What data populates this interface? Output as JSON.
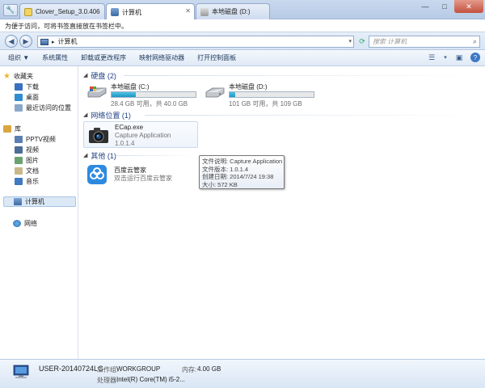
{
  "tabs": [
    {
      "label": "Clover_Setup_3.0.406",
      "active": false
    },
    {
      "label": "计算机",
      "active": true
    },
    {
      "label": "本地磁盘 (D:)",
      "active": false
    }
  ],
  "hint_bar": {
    "text": "为便于访问，可将书签直接放在书签栏中。"
  },
  "address": {
    "path": "计算机",
    "search_placeholder": "搜索 计算机"
  },
  "command_bar": {
    "items": [
      "组织 ▼",
      "系统属性",
      "卸载或更改程序",
      "映射网络驱动器",
      "打开控制面板"
    ]
  },
  "nav": {
    "favorites": {
      "label": "收藏夹",
      "items": [
        "下载",
        "桌面",
        "最近访问的位置"
      ]
    },
    "libraries": {
      "label": "库",
      "items": [
        "PPTV视频",
        "视频",
        "图片",
        "文档",
        "音乐"
      ]
    },
    "computer": "计算机",
    "network": "网络"
  },
  "groups": {
    "disks": {
      "header": "硬盘 (2)"
    },
    "network": {
      "header": "网络位置 (1)"
    },
    "other": {
      "header": "其他 (1)"
    }
  },
  "drives": [
    {
      "name": "本地磁盘 (C:)",
      "size": "28.4 GB 可用，共 40.0 GB",
      "used_fraction": 0.29
    },
    {
      "name": "本地磁盘 (D:)",
      "size": "101 GB 可用，共 109 GB",
      "used_fraction": 0.07
    }
  ],
  "network_item": {
    "name": "ECap.exe",
    "description": "Capture Application",
    "version": "1.0.1.4"
  },
  "other_item": {
    "name": "百度云管家",
    "description": "双击运行百度云管家"
  },
  "tooltip": {
    "line1": "文件说明: Capture Application",
    "line2": "文件版本: 1.0.1.4",
    "line3": "创建日期: 2014/7/24 19:38",
    "line4": "大小: 572 KB"
  },
  "details": {
    "name": "USER-20140724LG",
    "workgroup_label": "工作组:",
    "workgroup": "WORKGROUP",
    "memory_label": "内存:",
    "memory": "4.00 GB",
    "processor_label": "处理器:",
    "processor": "Intel(R) Core(TM) i5-2..."
  },
  "colors": {
    "accent": "#1e3f82",
    "drive_bar": "#1a95c4",
    "close": "#c4503f"
  }
}
